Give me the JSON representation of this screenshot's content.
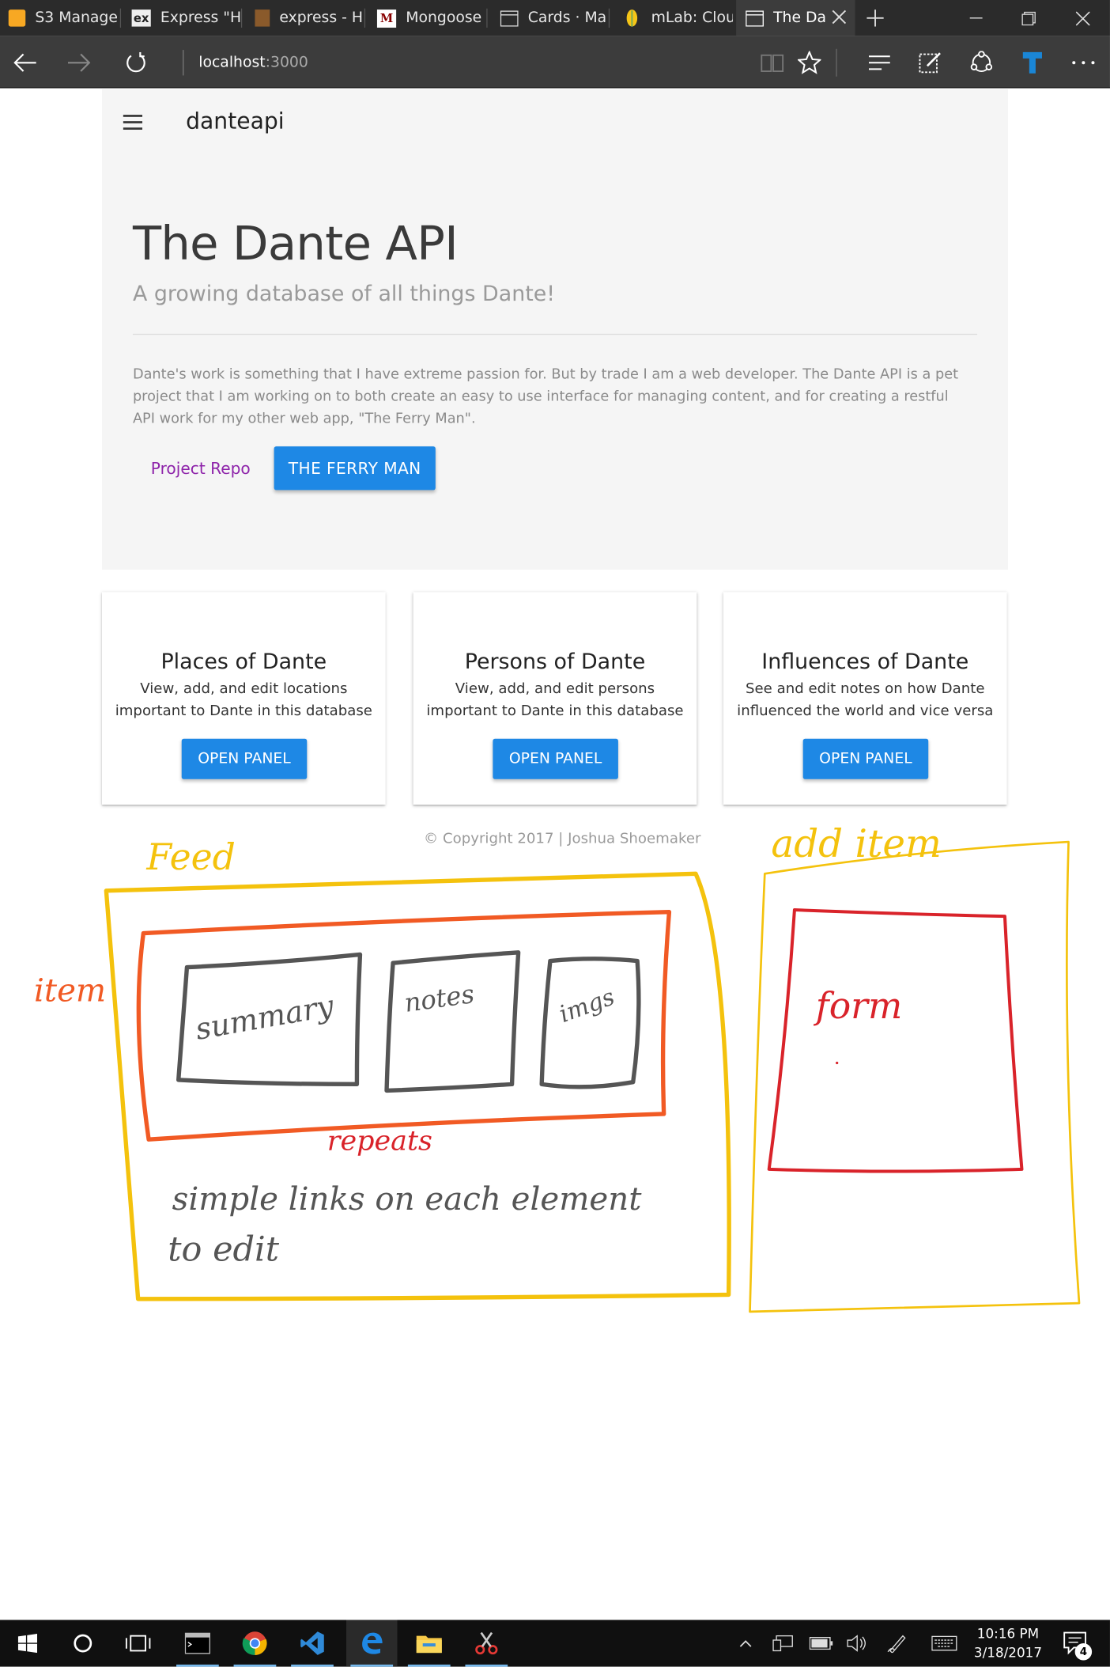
{
  "tabs": [
    {
      "title": "S3 Manage",
      "icon": "aws-box-icon"
    },
    {
      "title": "Express \"H",
      "icon": "express-ex-icon"
    },
    {
      "title": "express - H",
      "icon": "book-icon"
    },
    {
      "title": "Mongoose",
      "icon": "mongoose-m-icon"
    },
    {
      "title": "Cards · Ma",
      "icon": "page-icon"
    },
    {
      "title": "mLab: Clou",
      "icon": "mlab-leaf-icon"
    },
    {
      "title": "The Da",
      "icon": "page-icon"
    }
  ],
  "address": {
    "host": "localhost",
    "port": ":3000"
  },
  "site": {
    "brand": "danteapi",
    "title": "The Dante API",
    "subtitle": "A growing database of all things Dante!",
    "description": "Dante's work is something that I have extreme passion for. But by trade I am a web developer. The Dante API is a pet project that I am working on to both create an easy to use interface for managing content, and for creating a restful API work for my other web app, \"The Ferry Man\".",
    "repo_link": "Project Repo",
    "ferry_button": "THE FERRY MAN"
  },
  "cards": [
    {
      "title": "Places of Dante",
      "text": "View, add, and edit locations important to Dante in this database",
      "button": "OPEN PANEL"
    },
    {
      "title": "Persons of Dante",
      "text": "View, add, and edit persons important to Dante in this database",
      "button": "OPEN PANEL"
    },
    {
      "title": "Influences of Dante",
      "text": "See and edit notes on how Dante influenced the world and vice versa",
      "button": "OPEN PANEL"
    }
  ],
  "footer": {
    "copyright": "© Copyright 2017 | Joshua Shoemaker"
  },
  "sketch": {
    "feed": "Feed",
    "item": "item",
    "summary": "summary",
    "notes": "notes",
    "imgs": "imgs",
    "repeats": "repeats",
    "note_line1": "simple links on each element",
    "note_line2": "to edit",
    "add_item": "add item",
    "form": "form",
    "colors": {
      "yellow": "#f4c20d",
      "orange": "#f15a24",
      "red": "#d9232a",
      "gray": "#555555"
    }
  },
  "taskbar": {
    "time": "10:16 PM",
    "date": "3/18/2017",
    "notifications": "4"
  }
}
